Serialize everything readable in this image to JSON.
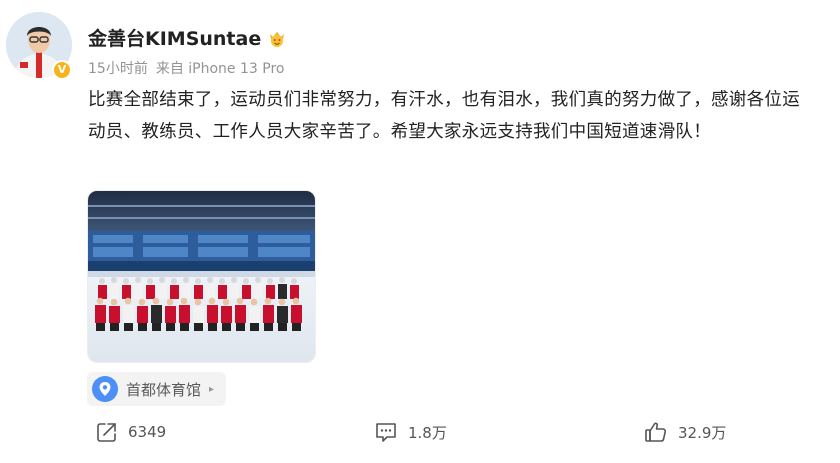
{
  "user": {
    "name": "金善台KIMSuntae",
    "verified_badge": "V",
    "member_icon": "crown-heart-eyes-emoji"
  },
  "meta": {
    "time": "15小时前",
    "source": "来自 iPhone 13 Pro"
  },
  "post": {
    "text": "比赛全部结束了，运动员们非常努力，有汗水，也有泪水，我们真的努力做了，感谢各位运动员、教练员、工作人员大家辛苦了。希望大家永远支持我们中国短道速滑队！"
  },
  "location": {
    "label": "首都体育馆",
    "icon": "location-pin-icon"
  },
  "actions": {
    "share_count": "6349",
    "comment_count": "1.8万",
    "like_count": "32.9万"
  },
  "colors": {
    "accent_blue": "#4b8ff7",
    "verified_gold": "#f6b31b",
    "meta_gray": "#939393"
  }
}
